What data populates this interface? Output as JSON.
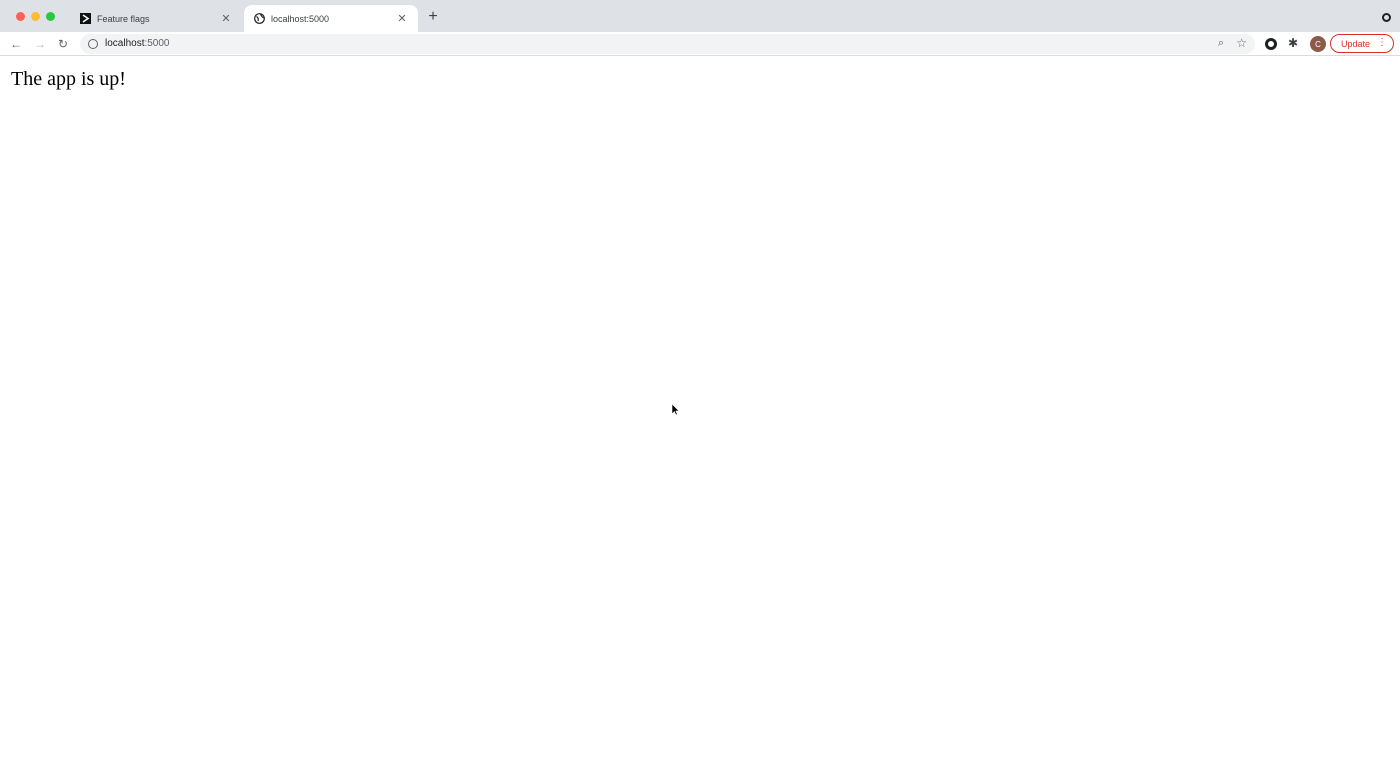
{
  "browser": {
    "tabs": [
      {
        "title": "Feature flags",
        "active": false,
        "icon": "launchdarkly-icon"
      },
      {
        "title": "localhost:5000",
        "active": true,
        "icon": "globe-icon"
      }
    ],
    "address_bar": {
      "host": "localhost",
      "port_suffix": ":5000"
    },
    "profile_initial": "C",
    "update_label": "Update"
  },
  "page": {
    "message": "The app is up!"
  },
  "colors": {
    "tabstrip": "#dee1e6",
    "update_accent": "#d93025"
  }
}
